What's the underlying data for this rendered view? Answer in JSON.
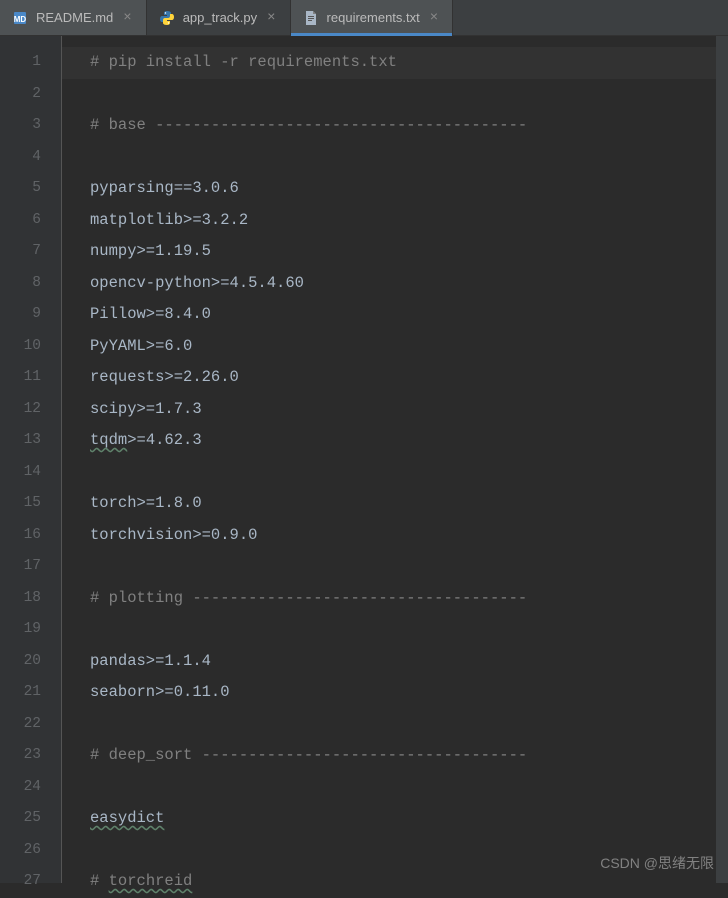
{
  "tabs": [
    {
      "label": "README.md",
      "icon": "md-file-icon",
      "active": false
    },
    {
      "label": "app_track.py",
      "icon": "python-file-icon",
      "active": false
    },
    {
      "label": "requirements.txt",
      "icon": "text-file-icon",
      "active": true
    }
  ],
  "editor": {
    "lines": [
      {
        "num": "1",
        "type": "comment",
        "text": "# pip install -r requirements.txt",
        "highlighted": true
      },
      {
        "num": "2",
        "type": "empty",
        "text": ""
      },
      {
        "num": "3",
        "type": "comment",
        "text": "# base ----------------------------------------"
      },
      {
        "num": "4",
        "type": "empty",
        "text": ""
      },
      {
        "num": "5",
        "type": "pkg",
        "text": "pyparsing==3.0.6"
      },
      {
        "num": "6",
        "type": "pkg",
        "text": "matplotlib>=3.2.2"
      },
      {
        "num": "7",
        "type": "pkg",
        "text": "numpy>=1.19.5"
      },
      {
        "num": "8",
        "type": "pkg",
        "text": "opencv-python>=4.5.4.60"
      },
      {
        "num": "9",
        "type": "pkg",
        "text": "Pillow>=8.4.0"
      },
      {
        "num": "10",
        "type": "pkg",
        "text": "PyYAML>=6.0"
      },
      {
        "num": "11",
        "type": "pkg",
        "text": "requests>=2.26.0"
      },
      {
        "num": "12",
        "type": "pkg",
        "text": "scipy>=1.7.3"
      },
      {
        "num": "13",
        "type": "pkg-underlined",
        "prefix": "tqdm",
        "suffix": ">=4.62.3"
      },
      {
        "num": "14",
        "type": "empty",
        "text": ""
      },
      {
        "num": "15",
        "type": "pkg",
        "text": "torch>=1.8.0"
      },
      {
        "num": "16",
        "type": "pkg",
        "text": "torchvision>=0.9.0"
      },
      {
        "num": "17",
        "type": "empty",
        "text": ""
      },
      {
        "num": "18",
        "type": "comment",
        "text": "# plotting ------------------------------------"
      },
      {
        "num": "19",
        "type": "empty",
        "text": ""
      },
      {
        "num": "20",
        "type": "pkg",
        "text": "pandas>=1.1.4"
      },
      {
        "num": "21",
        "type": "pkg",
        "text": "seaborn>=0.11.0"
      },
      {
        "num": "22",
        "type": "empty",
        "text": ""
      },
      {
        "num": "23",
        "type": "comment",
        "text": "# deep_sort -----------------------------------"
      },
      {
        "num": "24",
        "type": "empty",
        "text": ""
      },
      {
        "num": "25",
        "type": "pkg-underlined",
        "prefix": "easydict",
        "suffix": ""
      },
      {
        "num": "26",
        "type": "empty",
        "text": ""
      },
      {
        "num": "27",
        "type": "comment-underlined",
        "prefix": "# ",
        "underlined": "torchreid",
        "suffix": ""
      }
    ]
  },
  "watermark": "CSDN @思绪无限",
  "icons": {
    "close": "×"
  }
}
